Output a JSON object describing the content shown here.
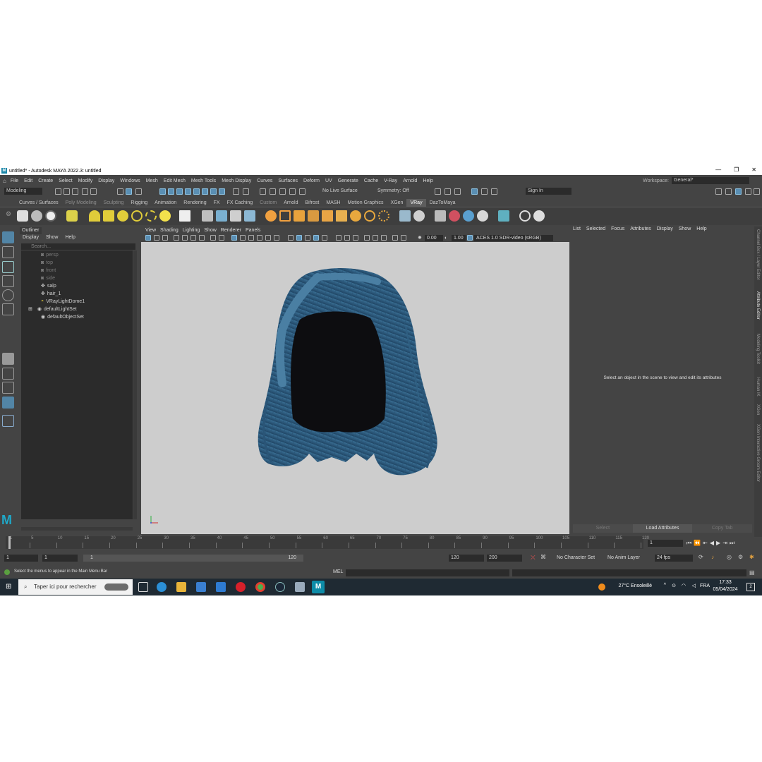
{
  "window": {
    "title": "untitled* - Autodesk MAYA 2022.3: untitled",
    "logo_letter": "M",
    "controls": [
      "—",
      "❐",
      "✕"
    ]
  },
  "menubar": {
    "items": [
      "File",
      "Edit",
      "Create",
      "Select",
      "Modify",
      "Display",
      "Windows",
      "Mesh",
      "Edit Mesh",
      "Mesh Tools",
      "Mesh Display",
      "Curves",
      "Surfaces",
      "Deform",
      "UV",
      "Generate",
      "Cache",
      "V-Ray",
      "Arnold",
      "Help"
    ],
    "workspace_label": "Workspace:",
    "workspace_value": "General*"
  },
  "statusline": {
    "menuset": "Modeling",
    "live_surface": "No Live Surface",
    "symmetry": "Symmetry: Off",
    "signin": "Sign In"
  },
  "shelf": {
    "tabs": [
      "Curves / Surfaces",
      "Poly Modeling",
      "Sculpting",
      "Rigging",
      "Animation",
      "Rendering",
      "FX",
      "FX Caching",
      "Custom",
      "Arnold",
      "Bifrost",
      "MASH",
      "Motion Graphics",
      "XGen",
      "VRay",
      "DazToMaya"
    ],
    "dim_tabs": [
      1,
      2,
      8
    ],
    "active_tab": 14
  },
  "outliner": {
    "title": "Outliner",
    "menu": [
      "Display",
      "Show",
      "Help"
    ],
    "search_placeholder": "Search...",
    "items": [
      {
        "label": "persp",
        "dim": true,
        "icon": "camera-icon"
      },
      {
        "label": "top",
        "dim": true,
        "icon": "camera-icon"
      },
      {
        "label": "front",
        "dim": true,
        "icon": "camera-icon"
      },
      {
        "label": "side",
        "dim": true,
        "icon": "camera-icon"
      },
      {
        "label": "salp",
        "dim": false,
        "icon": "mesh-icon"
      },
      {
        "label": "hair_1",
        "dim": false,
        "icon": "mesh-icon"
      },
      {
        "label": "VRayLightDome1",
        "dim": false,
        "icon": "light-dome-icon"
      },
      {
        "label": "defaultLightSet",
        "dim": false,
        "icon": "set-icon"
      },
      {
        "label": "defaultObjectSet",
        "dim": false,
        "icon": "set-icon"
      }
    ]
  },
  "viewport": {
    "menu": [
      "View",
      "Shading",
      "Lighting",
      "Show",
      "Renderer",
      "Panels"
    ],
    "exposure": "0.00",
    "gamma": "1.00",
    "colorspace": "ACES 1.0 SDR-video (sRGB)"
  },
  "attribute_editor": {
    "menu": [
      "List",
      "Selected",
      "Focus",
      "Attributes",
      "Display",
      "Show",
      "Help"
    ],
    "message": "Select an object in the scene to view and edit its attributes",
    "buttons": [
      "Select",
      "Load Attributes",
      "Copy Tab"
    ],
    "side_tabs": [
      "Channel Box / Layer Editor",
      "Attribute Editor",
      "Modeling Toolkit",
      "Human IK",
      "XGen",
      "XGen Interactive Groom Editor"
    ],
    "active_side_tab": 1
  },
  "timeline": {
    "ticks": [
      "1",
      "5",
      "10",
      "15",
      "20",
      "25",
      "30",
      "35",
      "40",
      "45",
      "50",
      "55",
      "60",
      "65",
      "70",
      "75",
      "80",
      "85",
      "90",
      "95",
      "100",
      "105",
      "110",
      "115",
      "120"
    ],
    "current_frame": "1"
  },
  "range": {
    "start": "1",
    "anim_start": "1",
    "slider_start": "1",
    "slider_end": "120",
    "end": "120",
    "anim_end": "200",
    "character_set": "No Character Set",
    "anim_layer": "No Anim Layer",
    "fps": "24 fps"
  },
  "helpline": {
    "text": "Select the menus to appear in the Main Menu Bar",
    "cmd_lang": "MEL"
  },
  "taskbar": {
    "search_placeholder": "Taper ici pour rechercher",
    "weather": "27°C  Ensoleillé",
    "lang": "FRA",
    "time": "17:33",
    "date": "05/04/2024",
    "notif_count": "2"
  }
}
